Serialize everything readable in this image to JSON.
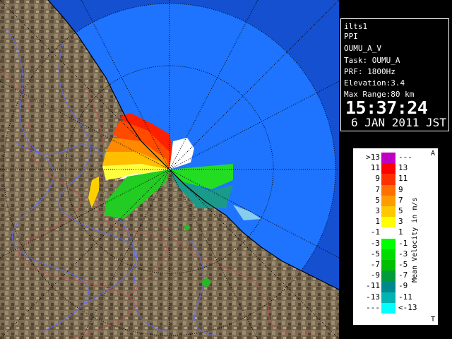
{
  "info": {
    "site": "ilts1",
    "scan_type": "PPI",
    "product": "OUMU_A_V",
    "task": "Task: OUMU_A",
    "prf": "PRF: 1800Hz",
    "elevation": "Elevation:3.4",
    "max_range": "Max Range:80 km",
    "time": "15:37:24",
    "date": "6 JAN 2011 JST"
  },
  "legend": {
    "title": "Mean Velocity in m/s",
    "top_marker": "A",
    "bottom_marker": "T",
    "rows": [
      {
        "left": ">13",
        "right": "---",
        "color": "#c000c0"
      },
      {
        "left": "11",
        "right": "13",
        "color": "#ff0000"
      },
      {
        "left": "9",
        "right": "11",
        "color": "#ff3000"
      },
      {
        "left": "7",
        "right": "9",
        "color": "#ff7000"
      },
      {
        "left": "5",
        "right": "7",
        "color": "#ff9c00"
      },
      {
        "left": "3",
        "right": "5",
        "color": "#ffc800"
      },
      {
        "left": "1",
        "right": "3",
        "color": "#ffff00"
      },
      {
        "left": "-1",
        "right": "1",
        "color": "#ffffff"
      },
      {
        "left": "-3",
        "right": "-1",
        "color": "#00ff00"
      },
      {
        "left": "-5",
        "right": "-3",
        "color": "#00dc00"
      },
      {
        "left": "-7",
        "right": "-5",
        "color": "#00be00"
      },
      {
        "left": "-9",
        "right": "-7",
        "color": "#009c3c"
      },
      {
        "left": "-11",
        "right": "-9",
        "color": "#00888c"
      },
      {
        "left": "-13",
        "right": "-11",
        "color": "#00b4b4"
      },
      {
        "left": "---",
        "right": "<-13",
        "color": "#00ffff"
      }
    ]
  },
  "colors": {
    "sea": "#1a6cf0",
    "sea_range": "#1e74ff",
    "land": "#7a6a52",
    "rings": "#000000"
  }
}
